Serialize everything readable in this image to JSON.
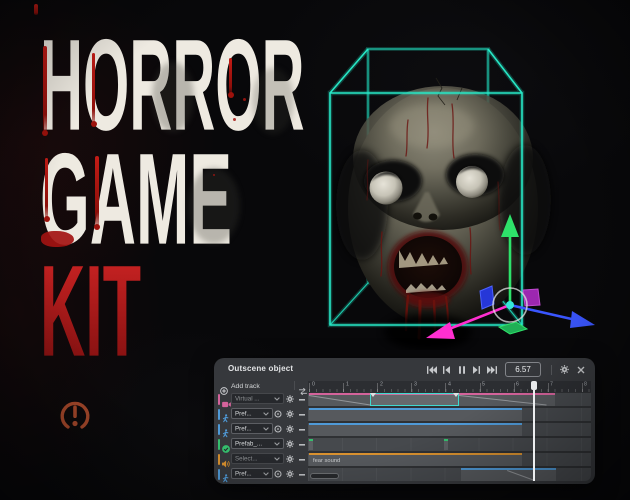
{
  "background": {
    "base": "#08080a",
    "accent_red": "#6d1412"
  },
  "hero": {
    "line1": "HORROR",
    "line2": "GAME",
    "line3": "KIT",
    "text_color": "#eeeae1",
    "kit_color_top": "#cf2424",
    "kit_color_bottom": "#7e0f0f"
  },
  "logo": {
    "name": "broken-ring-exclamation-logo",
    "color": "#a8492b"
  },
  "scene": {
    "box_color": "#25e2c3",
    "gizmo": {
      "axis_up_color": "#2ee26a",
      "axis_left_color": "#ff2fd0",
      "axis_right_color": "#3a56ff",
      "center_dot_color": "#35e6d8",
      "plane_left_color": "#2637d8",
      "plane_right_color": "#9c27b0",
      "plane_ground_color": "#1faf55"
    }
  },
  "timeline": {
    "title": "Outscene object",
    "time_display": "6.57",
    "playhead_seconds": 6.57,
    "add_track_label": "Add track",
    "transport": [
      "skip-start-icon",
      "step-back-icon",
      "pause-icon",
      "step-forward-icon",
      "skip-end-icon"
    ],
    "header_icons": [
      "settings-icon",
      "close-icon"
    ],
    "ruler_ticks": [
      "0",
      "1",
      "2",
      "3",
      "4",
      "5",
      "6",
      "7",
      "8"
    ],
    "tracks": [
      {
        "name": "Virtual ...",
        "icon": "camera-icon",
        "color": "#d4639b",
        "disabled": true,
        "record": false,
        "clip": {
          "start": 0,
          "end": 7.2
        },
        "selection": {
          "start": 1.8,
          "end": 4.4
        },
        "crossfade": true
      },
      {
        "name": "Pref...",
        "icon": "person-icon",
        "color": "#4f9ad8",
        "disabled": false,
        "record": true,
        "clip": {
          "start": 0,
          "end": 6.25
        }
      },
      {
        "name": "Pref...",
        "icon": "person-icon",
        "color": "#4f9ad8",
        "disabled": false,
        "record": true,
        "clip": {
          "start": 0,
          "end": 6.25
        }
      },
      {
        "name": "Prefab_...",
        "icon": "check-circle-icon",
        "color": "#35c06e",
        "disabled": false,
        "record": false,
        "markers": [
          0,
          3.95
        ]
      },
      {
        "name": "Select...",
        "icon": "audio-icon",
        "color": "#d9912f",
        "disabled": true,
        "record": false,
        "clip": {
          "start": 0,
          "end": 6.25,
          "label": "fear sound"
        }
      },
      {
        "name": "Pref...",
        "icon": "person-icon",
        "color": "#4f9ad8",
        "disabled": false,
        "record": true,
        "clip": {
          "start": 4.45,
          "end": 7.25
        },
        "fadeout": true
      }
    ]
  }
}
